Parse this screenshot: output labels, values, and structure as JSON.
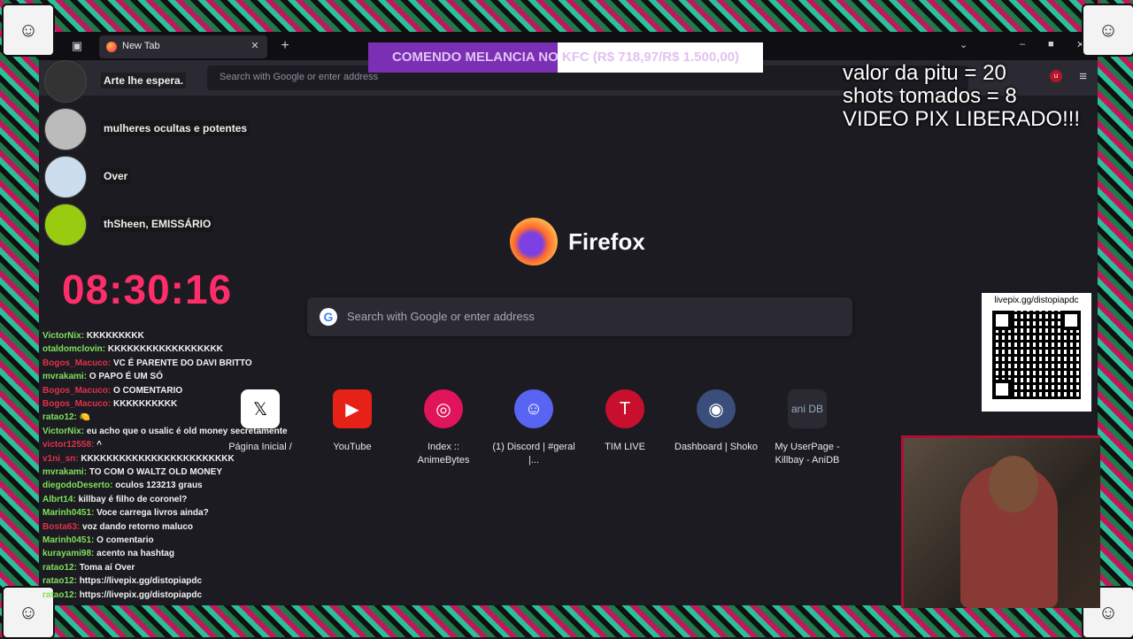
{
  "browser": {
    "tab_title": "New Tab",
    "url_placeholder": "Search with Google or enter address",
    "brand": "Firefox",
    "search_placeholder": "Search with Google or enter address",
    "shortcuts": [
      {
        "label": "Página Inicial /",
        "icon": "x-logo-icon"
      },
      {
        "label": "YouTube",
        "icon": "youtube-icon"
      },
      {
        "label": "Index :: AnimeBytes",
        "icon": "animebytes-icon"
      },
      {
        "label": "(1) Discord | #geral |...",
        "icon": "discord-icon"
      },
      {
        "label": "TIM LIVE",
        "icon": "tim-icon",
        "glyph": "T"
      },
      {
        "label": "Dashboard | Shoko",
        "icon": "shoko-icon"
      },
      {
        "label": "My UserPage - Killbay - AniDB",
        "icon": "anidb-icon",
        "glyph": "ani DB"
      }
    ]
  },
  "overlay": {
    "alert_text": "COMENDO MELANCIA NO KFC (R$ 718,97/R$ 1.500,00)",
    "alert_progress": 0.479,
    "stats": [
      "valor da pitu = 20",
      "shots tomados = 8",
      "VIDEO PIX LIBERADO!!!"
    ],
    "timer": "08:30:16",
    "qr_url": "livepix.gg/distopiapdc",
    "users": [
      {
        "name": "Arte lhe espera."
      },
      {
        "name": "mulheres ocultas e potentes"
      },
      {
        "name": "Over"
      },
      {
        "name": "thSheen, EMISSÁRIO"
      }
    ],
    "chat": [
      {
        "user": "VictorNix:",
        "msg": "KKKKKKKKK"
      },
      {
        "user": "otaldomclovin:",
        "msg": "KKKKKKKKKKKKKKKKKK"
      },
      {
        "user": "Bogos_Macuco:",
        "msg": "VC É PARENTE DO DAVI BRITTO",
        "color": "#e0314a"
      },
      {
        "user": "mvrakami:",
        "msg": "O PAPO É UM SÓ"
      },
      {
        "user": "Bogos_Macuco:",
        "msg": "O COMENTARIO",
        "color": "#e0314a"
      },
      {
        "user": "Bogos_Macuco:",
        "msg": "KKKKKKKKKK",
        "color": "#e0314a"
      },
      {
        "user": "ratao12:",
        "msg": "🍋"
      },
      {
        "user": "VictorNix:",
        "msg": "eu acho que o usalic é old money secretamente"
      },
      {
        "user": "victor12558:",
        "msg": "^",
        "color": "#e0314a"
      },
      {
        "user": "v1ni_sn:",
        "msg": "KKKKKKKKKKKKKKKKKKKKKKKK",
        "color": "#e0314a"
      },
      {
        "user": "mvrakami:",
        "msg": "TO COM O WALTZ OLD MONEY"
      },
      {
        "user": "diegodoDeserto:",
        "msg": "oculos 123213 graus"
      },
      {
        "user": "Albrt14:",
        "msg": "killbay é filho de coronel?"
      },
      {
        "user": "Marinh0451:",
        "msg": "Voce carrega livros ainda?"
      },
      {
        "user": "Bosta63:",
        "msg": "voz dando retorno maluco",
        "color": "#e0314a"
      },
      {
        "user": "Marinh0451:",
        "msg": "O comentario"
      },
      {
        "user": "kurayami98:",
        "msg": "acento na hashtag"
      },
      {
        "user": "ratao12:",
        "msg": "Toma aí Over"
      },
      {
        "user": "ratao12:",
        "msg": "https://livepix.gg/distopiapdc"
      },
      {
        "user": "ratao12:",
        "msg": "https://livepix.gg/distopiapdc"
      }
    ]
  }
}
